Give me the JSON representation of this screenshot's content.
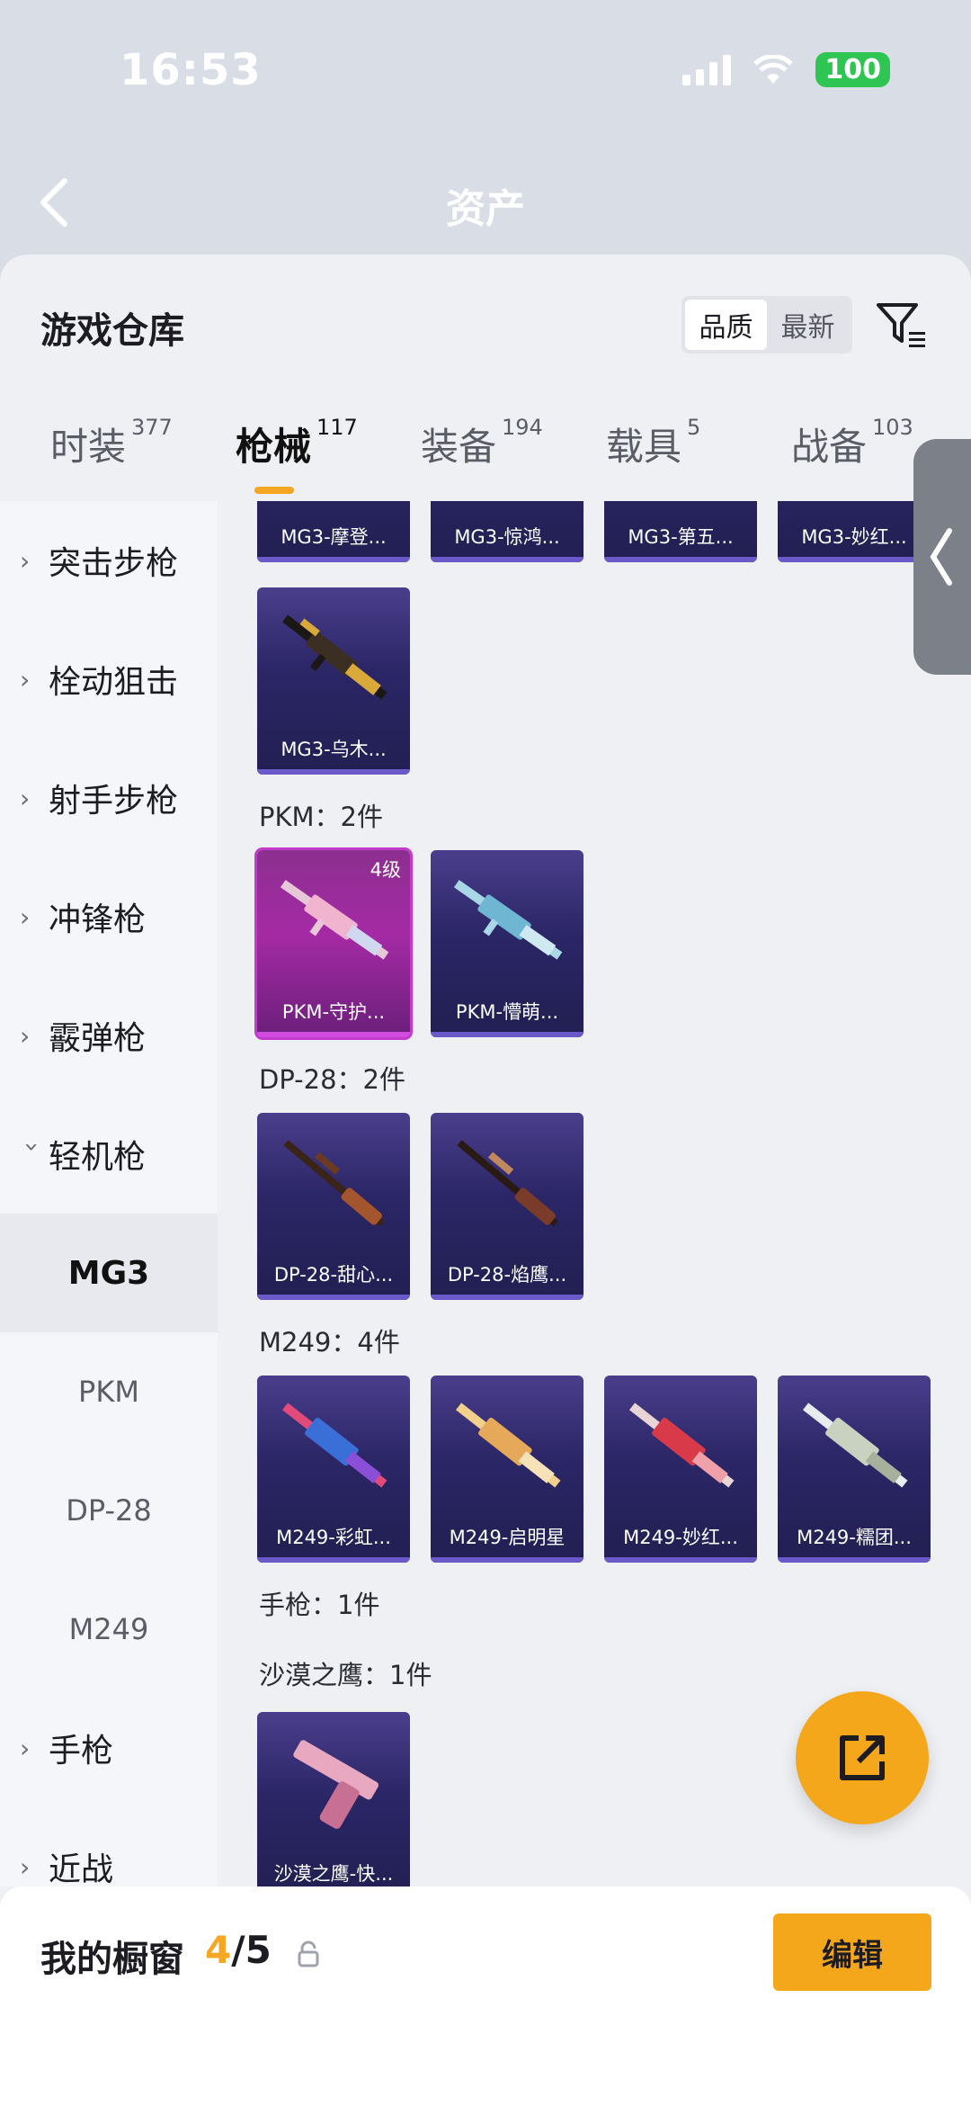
{
  "status_bar": {
    "time": "16:53",
    "battery": "100"
  },
  "header": {
    "title": "资产"
  },
  "sheet": {
    "title": "游戏仓库",
    "sort": {
      "options": [
        "品质",
        "最新"
      ],
      "active": "品质"
    }
  },
  "tabs": [
    {
      "label": "时装",
      "count": "377"
    },
    {
      "label": "枪械",
      "count": "117"
    },
    {
      "label": "装备",
      "count": "194"
    },
    {
      "label": "载具",
      "count": "5"
    },
    {
      "label": "战备",
      "count": "103"
    }
  ],
  "categories": [
    {
      "label": "突击步枪"
    },
    {
      "label": "栓动狙击"
    },
    {
      "label": "射手步枪"
    },
    {
      "label": "冲锋枪"
    },
    {
      "label": "霰弹枪"
    },
    {
      "label": "轻机枪"
    }
  ],
  "subcategories": [
    "MG3",
    "PKM",
    "DP-28",
    "M249"
  ],
  "categories_after": [
    {
      "label": "手枪"
    },
    {
      "label": "近战"
    }
  ],
  "groups": {
    "mg3_top": [
      "MG3-摩登...",
      "MG3-惊鸿...",
      "MG3-第五...",
      "MG3-妙红..."
    ],
    "mg3_bottom": [
      "MG3-乌木..."
    ],
    "pkm": {
      "title": "PKM：2件",
      "items": [
        "PKM-守护...",
        "PKM-懵萌..."
      ],
      "level": "4级"
    },
    "dp28": {
      "title": "DP-28：2件",
      "items": [
        "DP-28-甜心...",
        "DP-28-焰鹰..."
      ]
    },
    "m249": {
      "title": "M249：4件",
      "items": [
        "M249-彩虹...",
        "M249-启明星",
        "M249-妙红...",
        "M249-糯团..."
      ]
    },
    "pistol": {
      "title": "手枪：1件"
    },
    "deagle": {
      "title": "沙漠之鹰：1件",
      "items": [
        "沙漠之鹰-快..."
      ]
    }
  },
  "bottom": {
    "showcase_label": "我的橱窗",
    "current": "4",
    "total": "/5",
    "edit_label": "编辑"
  },
  "colors": {
    "accent": "#f5a623",
    "card_bg": "#2b2666",
    "card_pink": "#a52aa5"
  }
}
